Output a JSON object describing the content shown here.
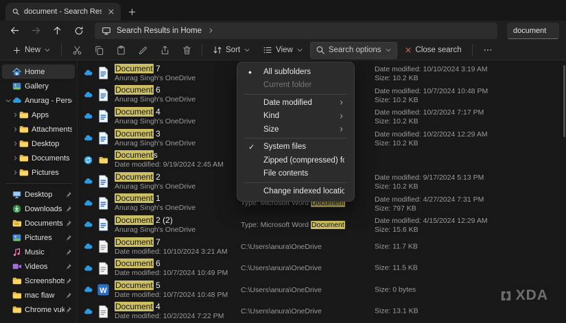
{
  "window": {
    "tab_title": "document - Search Results in I"
  },
  "navbar": {
    "breadcrumb": "Search Results in Home",
    "search_value": "document"
  },
  "toolbar": {
    "new_label": "New",
    "sort_label": "Sort",
    "view_label": "View",
    "search_options_label": "Search options",
    "close_search_label": "Close search"
  },
  "sidebar": {
    "items": [
      {
        "label": "Home",
        "icon": "home",
        "selected": true
      },
      {
        "label": "Gallery",
        "icon": "gallery"
      },
      {
        "label": "Anurag - Person",
        "icon": "onedrive",
        "expand": "down"
      },
      {
        "label": "Apps",
        "icon": "folder",
        "indent": true,
        "expand": "right"
      },
      {
        "label": "Attachments",
        "icon": "folder",
        "indent": true,
        "expand": "right"
      },
      {
        "label": "Desktop",
        "icon": "folder",
        "indent": true,
        "expand": "right"
      },
      {
        "label": "Documents",
        "icon": "folder",
        "indent": true,
        "expand": "right"
      },
      {
        "label": "Pictures",
        "icon": "folder",
        "indent": true,
        "expand": "right"
      },
      {
        "sep": true
      },
      {
        "label": "Desktop",
        "icon": "desktop",
        "pin": true
      },
      {
        "label": "Downloads",
        "icon": "download",
        "pin": true
      },
      {
        "label": "Documents",
        "icon": "docfolder",
        "pin": true
      },
      {
        "label": "Pictures",
        "icon": "gallery",
        "pin": true
      },
      {
        "label": "Music",
        "icon": "music",
        "pin": true
      },
      {
        "label": "Videos",
        "icon": "videos",
        "pin": true
      },
      {
        "label": "Screenshots",
        "icon": "folder",
        "pin": true
      },
      {
        "label": "mac flaw",
        "icon": "folder",
        "pin": true
      },
      {
        "label": "Chrome vuk",
        "icon": "folder",
        "pin": true
      }
    ]
  },
  "menu": {
    "items": [
      {
        "label": "All subfolders",
        "mark": "bullet"
      },
      {
        "label": "Current folder",
        "disabled": true
      },
      {
        "sep": true
      },
      {
        "label": "Date modified",
        "submenu": true
      },
      {
        "label": "Kind",
        "submenu": true
      },
      {
        "label": "Size",
        "submenu": true
      },
      {
        "sep": true
      },
      {
        "label": "System files",
        "mark": "check"
      },
      {
        "label": "Zipped (compressed) folders"
      },
      {
        "label": "File contents"
      },
      {
        "sep": true
      },
      {
        "label": "Change indexed locations"
      }
    ]
  },
  "files": [
    {
      "icon": "worddoc",
      "overlay": "cloud",
      "hl": "Document",
      "rest": " 7",
      "line2": "Anurag Singh's OneDrive",
      "date": "Date modified: 10/10/2024 3:19 AM",
      "size": "Size: 10.2 KB"
    },
    {
      "icon": "worddoc",
      "overlay": "cloud",
      "hl": "Document",
      "rest": " 6",
      "line2": "Anurag Singh's OneDrive",
      "date": "Date modified: 10/7/2024 10:48 PM",
      "size": "Size: 10.2 KB"
    },
    {
      "icon": "worddoc",
      "overlay": "cloud",
      "hl": "Document",
      "rest": " 4",
      "line2": "Anurag Singh's OneDrive",
      "date": "Date modified: 10/2/2024 7:17 PM",
      "size": "Size: 10.2 KB"
    },
    {
      "icon": "worddoc",
      "overlay": "cloud",
      "hl": "Document",
      "rest": " 3",
      "line2": "Anurag Singh's OneDrive",
      "date": "Date modified: 10/2/2024 12:29 AM",
      "size": "Size: 10.2 KB"
    },
    {
      "icon": "folder",
      "overlay": "sync",
      "hl": "Document",
      "rest": "s",
      "line2": "Date modified: 9/19/2024 2:45 AM"
    },
    {
      "icon": "worddoc",
      "overlay": "cloud",
      "hl": "Document",
      "rest": " 2",
      "line2": "Anurag Singh's OneDrive",
      "date": "Date modified: 9/17/2024 5:13 PM",
      "size": "Size: 10.2 KB"
    },
    {
      "icon": "worddoc",
      "overlay": "cloud",
      "hl": "Document",
      "rest": " 1",
      "line2": "Anurag Singh's OneDrive",
      "mid": "Type: Microsoft Word ",
      "mid_hl": "Document",
      "date": "Date modified: 4/27/2024 7:31 PM",
      "size": "Size: 797 KB"
    },
    {
      "icon": "worddoc",
      "overlay": "cloud",
      "hl": "Document",
      "rest": " 2 (2)",
      "line2": "Anurag Singh's OneDrive",
      "mid": "Type: Microsoft Word ",
      "mid_hl": "Document",
      "date": "Date modified: 4/15/2024 12:29 AM",
      "size": "Size: 15.6 KB"
    },
    {
      "icon": "doc",
      "overlay": "cloud",
      "hl": "Document",
      "rest": " 7",
      "line2": "Date modified: 10/10/2024 3:21 AM",
      "mid": "C:\\Users\\anura\\OneDrive",
      "size": "Size: 11.7 KB"
    },
    {
      "icon": "doc",
      "overlay": "cloud",
      "hl": "Document",
      "rest": " 6",
      "line2": "Date modified: 10/7/2024 10:49 PM",
      "mid": "C:\\Users\\anura\\OneDrive",
      "size": "Size: 11.5 KB"
    },
    {
      "icon": "wordapp",
      "overlay": "cloud",
      "hl": "Document",
      "rest": " 5",
      "line2": "Date modified: 10/7/2024 10:48 PM",
      "mid": "C:\\Users\\anura\\OneDrive",
      "size": "Size: 0 bytes"
    },
    {
      "icon": "doc",
      "overlay": "cloud",
      "hl": "Document",
      "rest": " 4",
      "line2": "Date modified: 10/2/2024 7:22 PM",
      "mid": "C:\\Users\\anura\\OneDrive",
      "size": "Size: 13.1 KB"
    }
  ],
  "watermark": {
    "text": "XDA"
  },
  "colors": {
    "highlight": "#cdbf63",
    "accent_blue": "#2a9be0",
    "folder_yellow": "#f3c64e"
  }
}
